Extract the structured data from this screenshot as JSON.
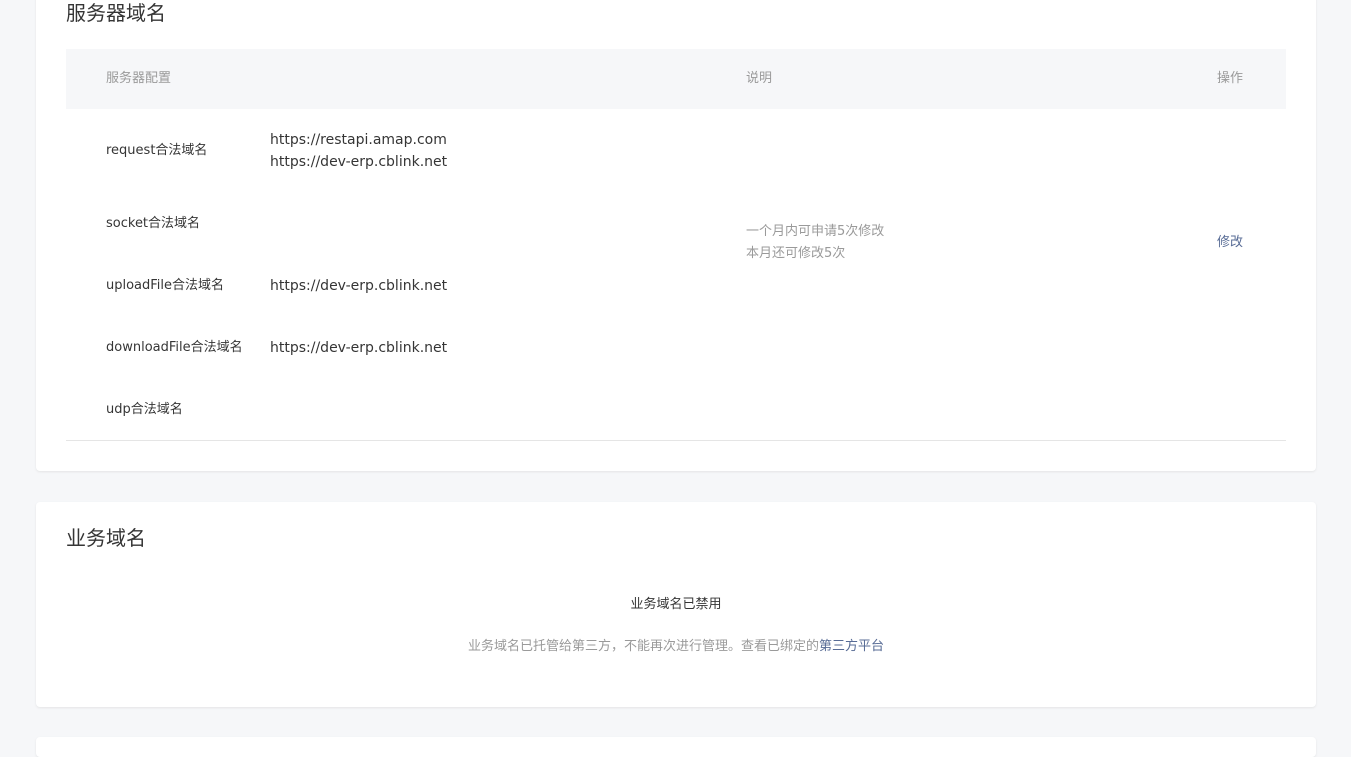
{
  "server_domain": {
    "title": "服务器域名",
    "headers": {
      "config": "服务器配置",
      "description": "说明",
      "operation": "操作"
    },
    "rows": [
      {
        "label": "request合法域名",
        "values": [
          "https://restapi.amap.com",
          "https://dev-erp.cblink.net"
        ]
      },
      {
        "label": "socket合法域名",
        "values": []
      },
      {
        "label": "uploadFile合法域名",
        "values": [
          "https://dev-erp.cblink.net"
        ]
      },
      {
        "label": "downloadFile合法域名",
        "values": [
          "https://dev-erp.cblink.net"
        ]
      },
      {
        "label": "udp合法域名",
        "values": []
      }
    ],
    "description_lines": [
      "一个月内可申请5次修改",
      "本月还可修改5次"
    ],
    "modify_label": "修改"
  },
  "business_domain": {
    "title": "业务域名",
    "disabled_title": "业务域名已禁用",
    "disabled_desc": "业务域名已托管给第三方，不能再次进行管理。查看已绑定的",
    "third_party_link": "第三方平台"
  }
}
